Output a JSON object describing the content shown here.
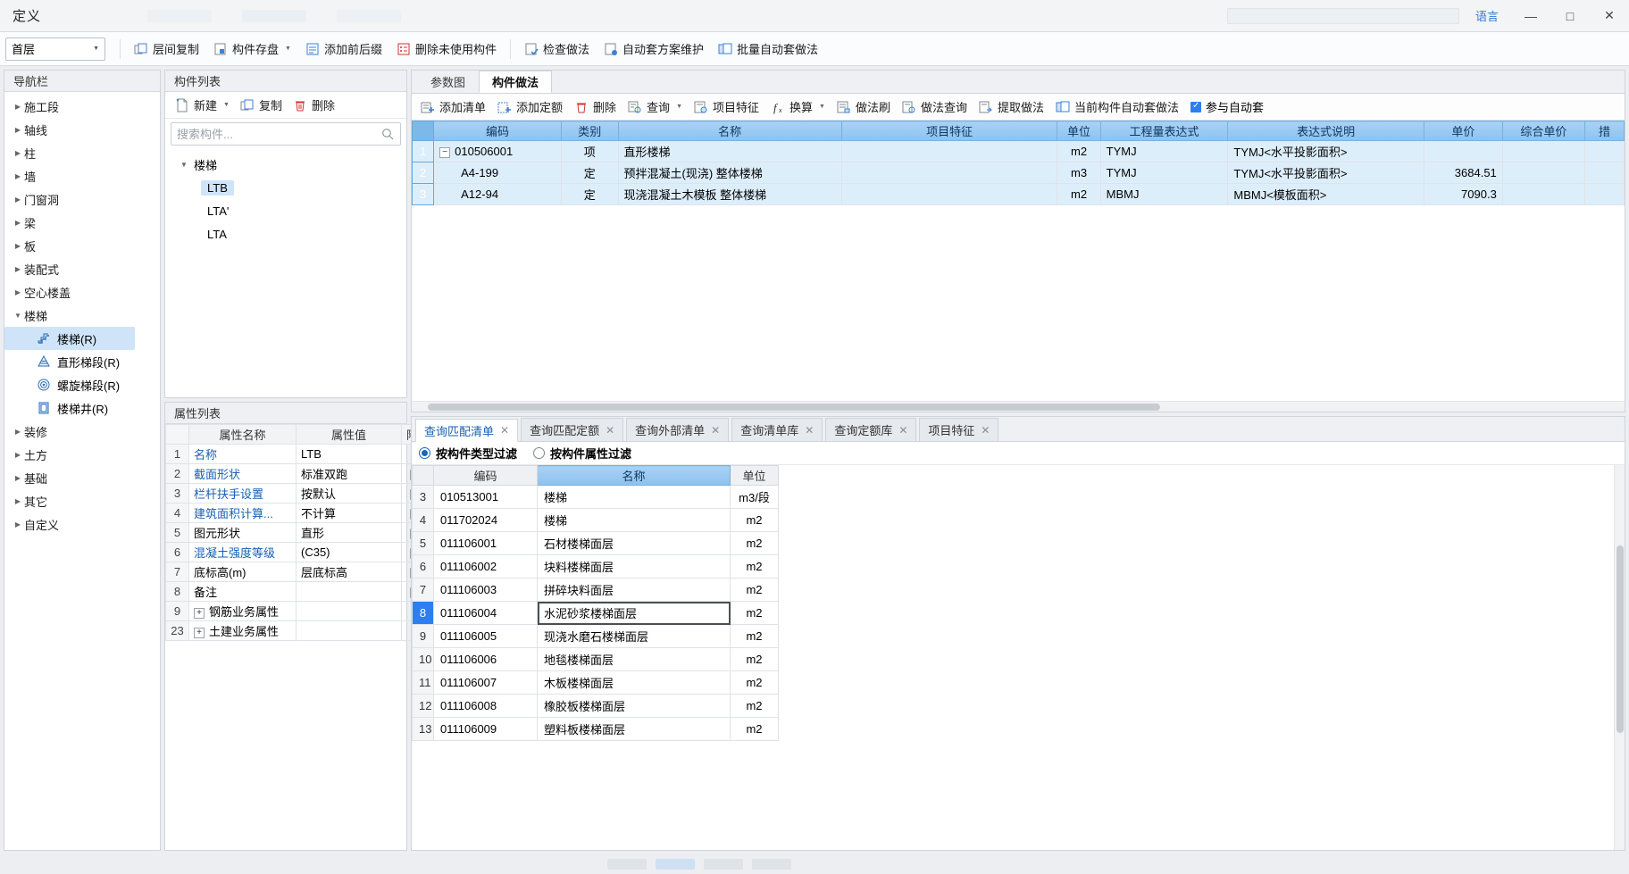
{
  "window": {
    "title": "定义",
    "badge": "语言",
    "minimize": "—",
    "maximize": "□",
    "close": "✕"
  },
  "ribbon": {
    "floor_select": "首层",
    "buttons": [
      {
        "label": "层间复制",
        "icon": "copy-between-floors-icon",
        "caret": false
      },
      {
        "label": "构件存盘",
        "icon": "save-component-icon",
        "caret": true
      },
      {
        "label": "添加前后缀",
        "icon": "add-affix-icon",
        "caret": false
      },
      {
        "label": "删除未使用构件",
        "icon": "delete-unused-icon",
        "caret": false
      },
      {
        "label": "检查做法",
        "icon": "check-method-icon",
        "caret": false
      },
      {
        "label": "自动套方案维护",
        "icon": "auto-scheme-icon",
        "caret": false
      },
      {
        "label": "批量自动套做法",
        "icon": "batch-auto-icon",
        "caret": false
      }
    ]
  },
  "nav": {
    "title": "导航栏",
    "items": [
      {
        "label": "施工段",
        "expanded": false
      },
      {
        "label": "轴线",
        "expanded": false
      },
      {
        "label": "柱",
        "expanded": false
      },
      {
        "label": "墙",
        "expanded": false
      },
      {
        "label": "门窗洞",
        "expanded": false
      },
      {
        "label": "梁",
        "expanded": false
      },
      {
        "label": "板",
        "expanded": false
      },
      {
        "label": "装配式",
        "expanded": false
      },
      {
        "label": "空心楼盖",
        "expanded": false
      },
      {
        "label": "楼梯",
        "expanded": true
      },
      {
        "label": "装修",
        "expanded": false
      },
      {
        "label": "土方",
        "expanded": false
      },
      {
        "label": "基础",
        "expanded": false
      },
      {
        "label": "其它",
        "expanded": false
      },
      {
        "label": "自定义",
        "expanded": false
      }
    ],
    "children": [
      {
        "label": "楼梯(R)",
        "icon": "stair-icon",
        "selected": true
      },
      {
        "label": "直形梯段(R)",
        "icon": "straight-flight-icon",
        "selected": false
      },
      {
        "label": "螺旋梯段(R)",
        "icon": "spiral-flight-icon",
        "selected": false
      },
      {
        "label": "楼梯井(R)",
        "icon": "stairwell-icon",
        "selected": false
      }
    ]
  },
  "component_list": {
    "title": "构件列表",
    "tools": [
      {
        "label": "新建",
        "icon": "new-file-icon",
        "caret": true
      },
      {
        "label": "复制",
        "icon": "copy-icon",
        "caret": false
      },
      {
        "label": "删除",
        "icon": "trash-icon",
        "caret": false
      }
    ],
    "search_placeholder": "搜索构件...",
    "group": "楼梯",
    "items": [
      {
        "label": "LTB",
        "selected": true
      },
      {
        "label": "LTA'",
        "selected": false
      },
      {
        "label": "LTA",
        "selected": false
      }
    ]
  },
  "property_list": {
    "title": "属性列表",
    "columns": [
      "",
      "属性名称",
      "属性值",
      "附加"
    ],
    "rows": [
      {
        "idx": "1",
        "name": "名称",
        "value": "LTB",
        "link": true,
        "check": false,
        "expandable": false
      },
      {
        "idx": "2",
        "name": "截面形状",
        "value": "标准双跑",
        "link": true,
        "check": true,
        "expandable": false
      },
      {
        "idx": "3",
        "name": "栏杆扶手设置",
        "value": "按默认",
        "link": true,
        "check": true,
        "expandable": false
      },
      {
        "idx": "4",
        "name": "建筑面积计算...",
        "value": "不计算",
        "link": true,
        "check": true,
        "expandable": false
      },
      {
        "idx": "5",
        "name": "图元形状",
        "value": "直形",
        "link": false,
        "check": true,
        "expandable": false
      },
      {
        "idx": "6",
        "name": "混凝土强度等级",
        "value": "(C35)",
        "link": true,
        "check": true,
        "expandable": false
      },
      {
        "idx": "7",
        "name": "底标高(m)",
        "value": "层底标高",
        "link": false,
        "check": true,
        "expandable": false
      },
      {
        "idx": "8",
        "name": "备注",
        "value": "",
        "link": false,
        "check": true,
        "expandable": false
      },
      {
        "idx": "9",
        "name": "钢筋业务属性",
        "value": "",
        "link": false,
        "check": false,
        "expandable": true
      },
      {
        "idx": "23",
        "name": "土建业务属性",
        "value": "",
        "link": false,
        "check": false,
        "expandable": true
      }
    ]
  },
  "main": {
    "tabs": [
      {
        "label": "参数图",
        "active": false
      },
      {
        "label": "构件做法",
        "active": true
      }
    ],
    "toolbar": [
      {
        "label": "添加清单",
        "icon": "add-list-icon",
        "caret": false
      },
      {
        "label": "添加定额",
        "icon": "add-quota-icon",
        "caret": false
      },
      {
        "label": "删除",
        "icon": "trash-icon",
        "caret": false
      },
      {
        "label": "查询",
        "icon": "query-icon",
        "caret": true
      },
      {
        "label": "项目特征",
        "icon": "feature-icon",
        "caret": false
      },
      {
        "label": "换算",
        "icon": "convert-icon",
        "caret": true
      },
      {
        "label": "做法刷",
        "icon": "method-brush-icon",
        "caret": false
      },
      {
        "label": "做法查询",
        "icon": "method-query-icon",
        "caret": false
      },
      {
        "label": "提取做法",
        "icon": "extract-method-icon",
        "caret": false
      },
      {
        "label": "当前构件自动套做法",
        "icon": "auto-apply-icon",
        "caret": false
      }
    ],
    "auto_checkbox": {
      "label": "参与自动套",
      "checked": true
    },
    "columns": [
      "编码",
      "类别",
      "名称",
      "项目特征",
      "单位",
      "工程量表达式",
      "表达式说明",
      "单价",
      "综合单价",
      "措"
    ],
    "rows": [
      {
        "idx": "1",
        "expander": "−",
        "code": "010506001",
        "category": "项",
        "name": "直形楼梯",
        "feature": "",
        "unit": "m2",
        "expr": "TYMJ",
        "expr_desc": "TYMJ<水平投影面积>",
        "price": "",
        "total_price": "",
        "selected": true,
        "level": 0
      },
      {
        "idx": "2",
        "expander": "",
        "code": "A4-199",
        "category": "定",
        "name": "预拌混凝土(现浇) 整体楼梯",
        "feature": "",
        "unit": "m3",
        "expr": "TYMJ",
        "expr_desc": "TYMJ<水平投影面积>",
        "price": "3684.51",
        "total_price": "",
        "selected": true,
        "level": 1
      },
      {
        "idx": "3",
        "expander": "",
        "code": "A12-94",
        "category": "定",
        "name": "现浇混凝土木模板 整体楼梯",
        "feature": "",
        "unit": "m2",
        "expr": "MBMJ",
        "expr_desc": "MBMJ<模板面积>",
        "price": "7090.3",
        "total_price": "",
        "selected": true,
        "level": 1
      }
    ]
  },
  "query_panel": {
    "tabs": [
      {
        "label": "查询匹配清单",
        "active": true
      },
      {
        "label": "查询匹配定额",
        "active": false
      },
      {
        "label": "查询外部清单",
        "active": false
      },
      {
        "label": "查询清单库",
        "active": false
      },
      {
        "label": "查询定额库",
        "active": false
      },
      {
        "label": "项目特征",
        "active": false
      }
    ],
    "close_glyph": "✕",
    "filters": [
      {
        "label": "按构件类型过滤",
        "selected": true
      },
      {
        "label": "按构件属性过滤",
        "selected": false
      }
    ],
    "columns": [
      "",
      "编码",
      "名称",
      "单位"
    ],
    "rows": [
      {
        "idx": "3",
        "code": "010513001",
        "name": "楼梯",
        "unit": "m3/段",
        "selected": false,
        "editing": false
      },
      {
        "idx": "4",
        "code": "011702024",
        "name": "楼梯",
        "unit": "m2",
        "selected": false,
        "editing": false
      },
      {
        "idx": "5",
        "code": "011106001",
        "name": "石材楼梯面层",
        "unit": "m2",
        "selected": false,
        "editing": false
      },
      {
        "idx": "6",
        "code": "011106002",
        "name": "块料楼梯面层",
        "unit": "m2",
        "selected": false,
        "editing": false
      },
      {
        "idx": "7",
        "code": "011106003",
        "name": "拼碎块料面层",
        "unit": "m2",
        "selected": false,
        "editing": false
      },
      {
        "idx": "8",
        "code": "011106004",
        "name": "水泥砂浆楼梯面层",
        "unit": "m2",
        "selected": true,
        "editing": true
      },
      {
        "idx": "9",
        "code": "011106005",
        "name": "现浇水磨石楼梯面层",
        "unit": "m2",
        "selected": false,
        "editing": false
      },
      {
        "idx": "10",
        "code": "011106006",
        "name": "地毯楼梯面层",
        "unit": "m2",
        "selected": false,
        "editing": false
      },
      {
        "idx": "11",
        "code": "011106007",
        "name": "木板楼梯面层",
        "unit": "m2",
        "selected": false,
        "editing": false
      },
      {
        "idx": "12",
        "code": "011106008",
        "name": "橡胶板楼梯面层",
        "unit": "m2",
        "selected": false,
        "editing": false
      },
      {
        "idx": "13",
        "code": "011106009",
        "name": "塑料板楼梯面层",
        "unit": "m2",
        "selected": false,
        "editing": false
      }
    ]
  }
}
